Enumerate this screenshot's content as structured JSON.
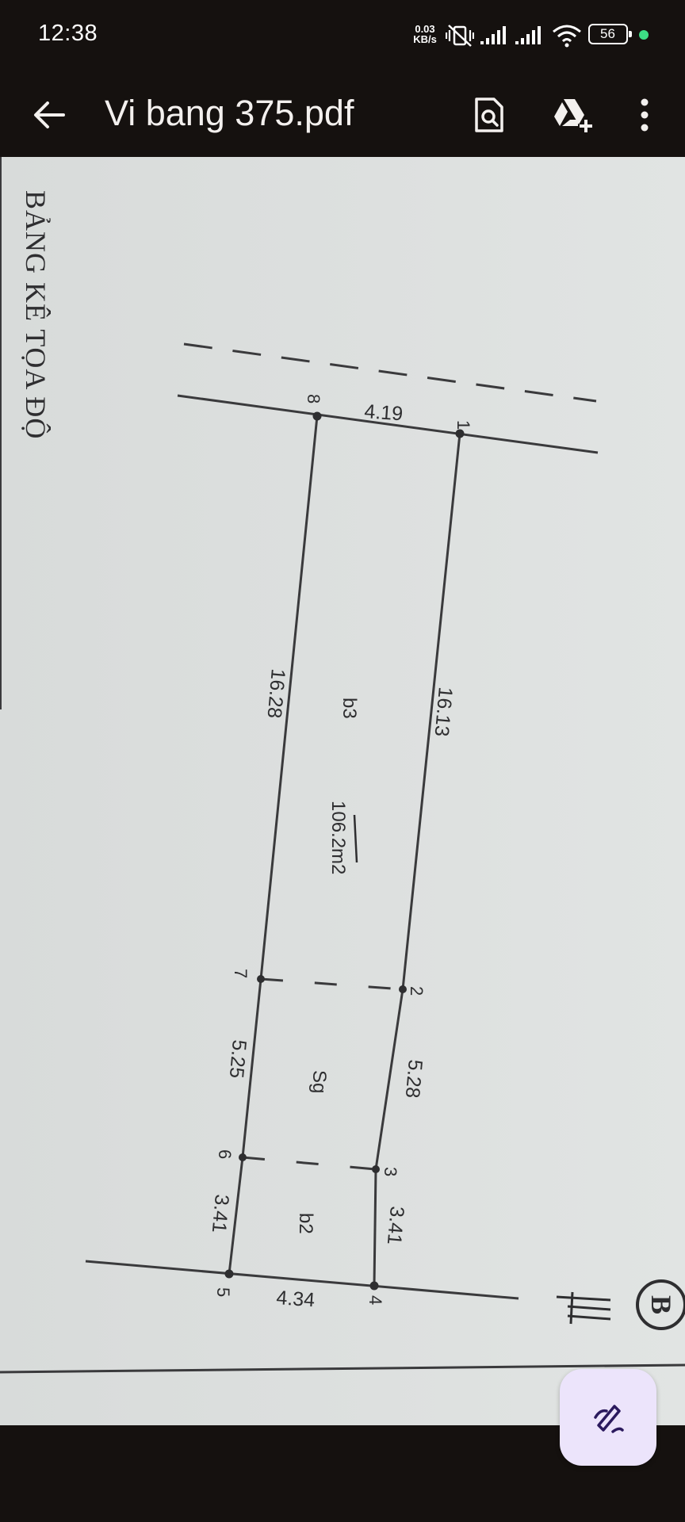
{
  "status_bar": {
    "time": "12:38",
    "net_speed_value": "0.03",
    "net_speed_unit": "KB/s",
    "battery_level": "56",
    "icons": [
      "vibrate-off-icon",
      "signal-icon",
      "signal-icon",
      "wifi-icon",
      "battery-icon",
      "privacy-dot-icon"
    ]
  },
  "toolbar": {
    "title": "Vi bang 375.pdf",
    "icons": [
      "back-arrow-icon",
      "search-document-icon",
      "drive-add-icon",
      "more-vert-icon"
    ]
  },
  "document": {
    "heading": "BẢNG KÊ TỌA ĐỘ",
    "points": [
      "1",
      "2",
      "3",
      "4",
      "5",
      "6",
      "7",
      "8"
    ],
    "dimensions": {
      "top": "4.19",
      "right_upper": "16.13",
      "left_upper": "16.28",
      "right_middle": "5.28",
      "left_middle": "5.25",
      "right_lower": "3.41",
      "left_lower": "3.41",
      "bottom": "4.34"
    },
    "zones": {
      "main": "b3",
      "area": "106.2m2",
      "middle": "Sg",
      "bottom": "b2"
    },
    "corner_mark": "B"
  },
  "fab": {
    "icon": "edit-pen-icon"
  },
  "colors": {
    "background": "#15110f",
    "paper": "#dcdfde",
    "ink": "#3a3a3c",
    "fab": "#ece4fb",
    "fab_icon": "#2b1a5e",
    "status_dot": "#3ddc84"
  }
}
